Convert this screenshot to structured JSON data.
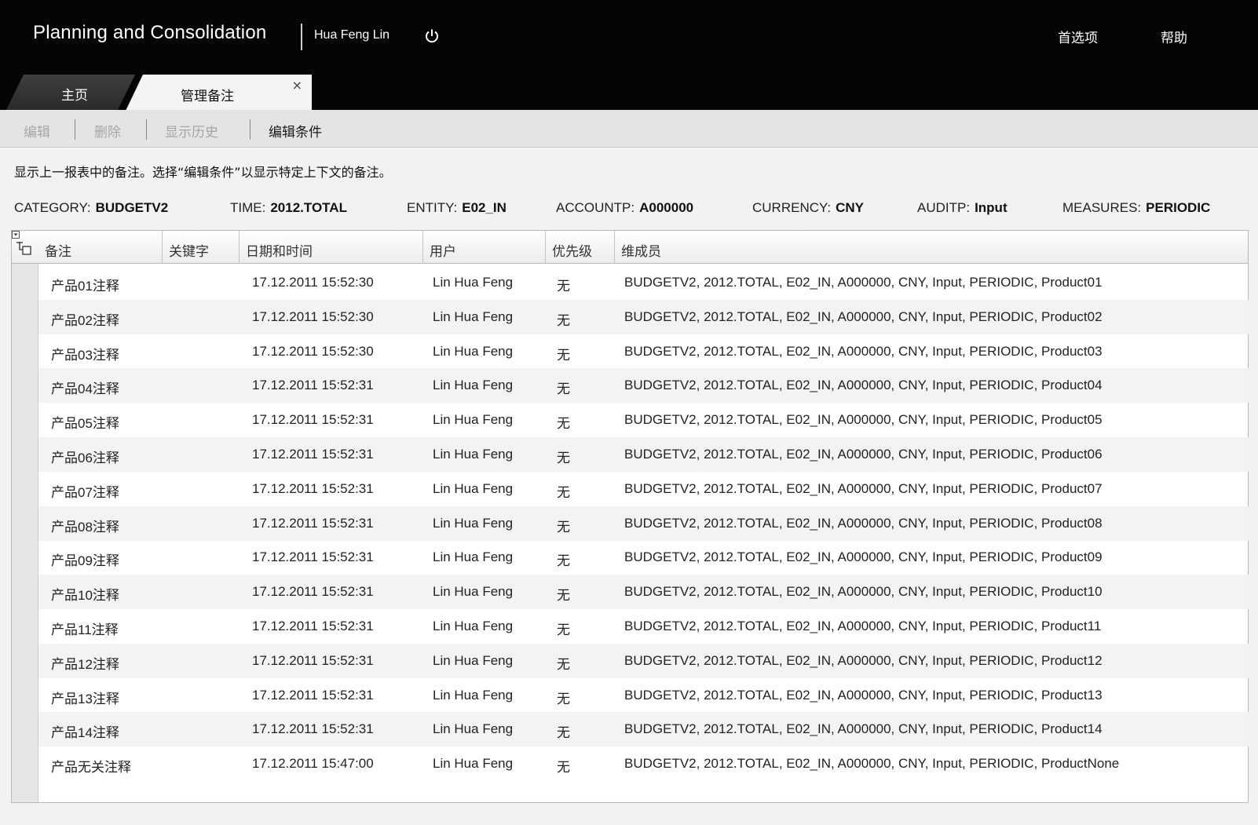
{
  "header": {
    "app_title": "Planning and Consolidation",
    "user_name": "Hua Feng Lin",
    "preferences_label": "首选项",
    "help_label": "帮助"
  },
  "tabs": [
    {
      "label": "主页",
      "active": false
    },
    {
      "label": "管理备注",
      "active": true
    }
  ],
  "tab_close_glyph": "×",
  "toolbar": {
    "items": [
      {
        "label": "编辑",
        "enabled": false
      },
      {
        "label": "删除",
        "enabled": false
      },
      {
        "label": "显示历史",
        "enabled": false
      },
      {
        "label": "编辑条件",
        "enabled": true
      }
    ]
  },
  "info_text": "显示上一报表中的备注。选择“编辑条件”以显示特定上下文的备注。",
  "context": [
    {
      "key": "CATEGORY:",
      "value": "BUDGETV2"
    },
    {
      "key": "TIME:",
      "value": "2012.TOTAL"
    },
    {
      "key": "ENTITY:",
      "value": "E02_IN"
    },
    {
      "key": "ACCOUNTP:",
      "value": "A000000"
    },
    {
      "key": "CURRENCY:",
      "value": "CNY"
    },
    {
      "key": "AUDITP:",
      "value": "Input"
    },
    {
      "key": "MEASURES:",
      "value": "PERIODIC"
    }
  ],
  "table": {
    "columns": [
      "备注",
      "关键字",
      "日期和时间",
      "用户",
      "优先级",
      "维成员"
    ],
    "rows": [
      {
        "note": "产品01注释",
        "keyword": "",
        "datetime": "17.12.2011 15:52:30",
        "user": "Lin Hua Feng",
        "priority": "无",
        "members": "BUDGETV2, 2012.TOTAL, E02_IN, A000000, CNY, Input, PERIODIC, Product01"
      },
      {
        "note": "产品02注释",
        "keyword": "",
        "datetime": "17.12.2011 15:52:30",
        "user": "Lin Hua Feng",
        "priority": "无",
        "members": "BUDGETV2, 2012.TOTAL, E02_IN, A000000, CNY, Input, PERIODIC, Product02"
      },
      {
        "note": "产品03注释",
        "keyword": "",
        "datetime": "17.12.2011 15:52:30",
        "user": "Lin Hua Feng",
        "priority": "无",
        "members": "BUDGETV2, 2012.TOTAL, E02_IN, A000000, CNY, Input, PERIODIC, Product03"
      },
      {
        "note": "产品04注释",
        "keyword": "",
        "datetime": "17.12.2011 15:52:31",
        "user": "Lin Hua Feng",
        "priority": "无",
        "members": "BUDGETV2, 2012.TOTAL, E02_IN, A000000, CNY, Input, PERIODIC, Product04"
      },
      {
        "note": "产品05注释",
        "keyword": "",
        "datetime": "17.12.2011 15:52:31",
        "user": "Lin Hua Feng",
        "priority": "无",
        "members": "BUDGETV2, 2012.TOTAL, E02_IN, A000000, CNY, Input, PERIODIC, Product05"
      },
      {
        "note": "产品06注释",
        "keyword": "",
        "datetime": "17.12.2011 15:52:31",
        "user": "Lin Hua Feng",
        "priority": "无",
        "members": "BUDGETV2, 2012.TOTAL, E02_IN, A000000, CNY, Input, PERIODIC, Product06"
      },
      {
        "note": "产品07注释",
        "keyword": "",
        "datetime": "17.12.2011 15:52:31",
        "user": "Lin Hua Feng",
        "priority": "无",
        "members": "BUDGETV2, 2012.TOTAL, E02_IN, A000000, CNY, Input, PERIODIC, Product07"
      },
      {
        "note": "产品08注释",
        "keyword": "",
        "datetime": "17.12.2011 15:52:31",
        "user": "Lin Hua Feng",
        "priority": "无",
        "members": "BUDGETV2, 2012.TOTAL, E02_IN, A000000, CNY, Input, PERIODIC, Product08"
      },
      {
        "note": "产品09注释",
        "keyword": "",
        "datetime": "17.12.2011 15:52:31",
        "user": "Lin Hua Feng",
        "priority": "无",
        "members": "BUDGETV2, 2012.TOTAL, E02_IN, A000000, CNY, Input, PERIODIC, Product09"
      },
      {
        "note": "产品10注释",
        "keyword": "",
        "datetime": "17.12.2011 15:52:31",
        "user": "Lin Hua Feng",
        "priority": "无",
        "members": "BUDGETV2, 2012.TOTAL, E02_IN, A000000, CNY, Input, PERIODIC, Product10"
      },
      {
        "note": "产品11注释",
        "keyword": "",
        "datetime": "17.12.2011 15:52:31",
        "user": "Lin Hua Feng",
        "priority": "无",
        "members": "BUDGETV2, 2012.TOTAL, E02_IN, A000000, CNY, Input, PERIODIC, Product11"
      },
      {
        "note": "产品12注释",
        "keyword": "",
        "datetime": "17.12.2011 15:52:31",
        "user": "Lin Hua Feng",
        "priority": "无",
        "members": "BUDGETV2, 2012.TOTAL, E02_IN, A000000, CNY, Input, PERIODIC, Product12"
      },
      {
        "note": "产品13注释",
        "keyword": "",
        "datetime": "17.12.2011 15:52:31",
        "user": "Lin Hua Feng",
        "priority": "无",
        "members": "BUDGETV2, 2012.TOTAL, E02_IN, A000000, CNY, Input, PERIODIC, Product13"
      },
      {
        "note": "产品14注释",
        "keyword": "",
        "datetime": "17.12.2011 15:52:31",
        "user": "Lin Hua Feng",
        "priority": "无",
        "members": "BUDGETV2, 2012.TOTAL, E02_IN, A000000, CNY, Input, PERIODIC, Product14"
      },
      {
        "note": "产品无关注释",
        "keyword": "",
        "datetime": "17.12.2011 15:47:00",
        "user": "Lin Hua Feng",
        "priority": "无",
        "members": "BUDGETV2, 2012.TOTAL, E02_IN, A000000, CNY, Input, PERIODIC, ProductNone"
      }
    ]
  },
  "icons": {
    "power": "power-icon",
    "column_menu": "column-menu-icon",
    "close": "close-icon"
  }
}
